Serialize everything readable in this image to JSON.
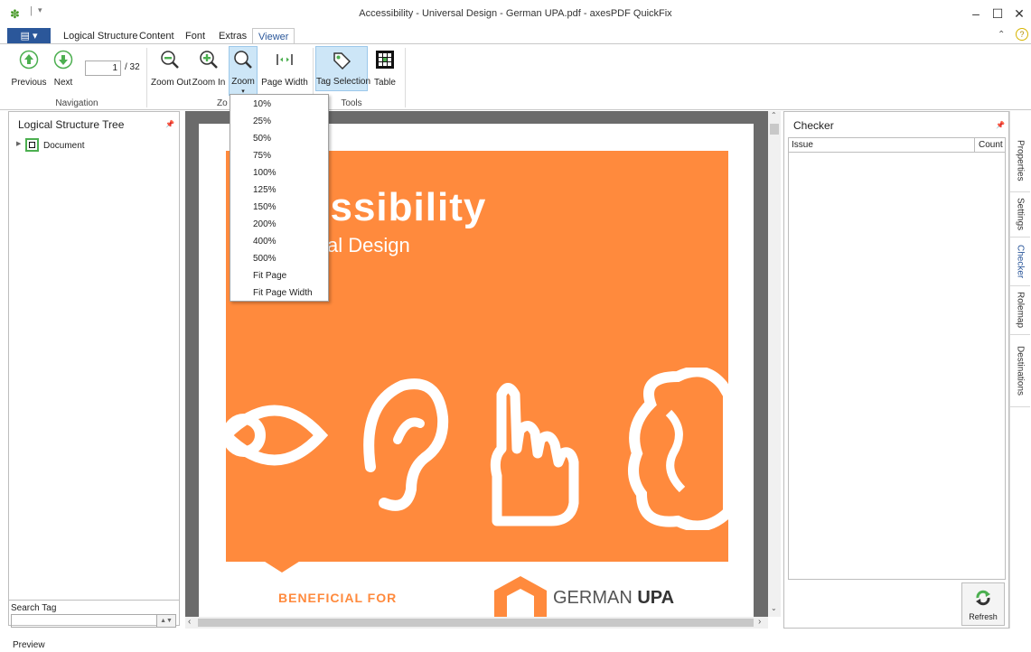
{
  "window": {
    "title": "Accessibility - Universal Design - German UPA.pdf - axesPDF QuickFix",
    "minimize": "–",
    "maximize": "☐",
    "close": "✕"
  },
  "ribbon_tabs": {
    "file": "▤ ▾",
    "items": [
      "Logical Structure",
      "Content",
      "Font",
      "Extras",
      "Viewer"
    ],
    "active": "Viewer"
  },
  "ribbon": {
    "navigation": {
      "previous": "Previous",
      "next": "Next",
      "page_value": "1",
      "page_total": "/ 32",
      "group_label": "Navigation"
    },
    "zoom": {
      "zoom_out": "Zoom Out",
      "zoom_in": "Zoom In",
      "zoom": "Zoom",
      "page_width": "Page Width",
      "group_label": "Zo"
    },
    "tools": {
      "tag_selection": "Tag Selection",
      "table": "Table",
      "group_label": "Tools"
    }
  },
  "zoom_menu": {
    "options": [
      "10%",
      "25%",
      "50%",
      "75%",
      "100%",
      "125%",
      "150%",
      "200%",
      "400%",
      "500%",
      "Fit Page",
      "Fit Page Width"
    ]
  },
  "left_pane": {
    "title": "Logical Structure Tree",
    "tree_root": "Document",
    "search_label": "Search Tag",
    "search_value": ""
  },
  "document": {
    "headline_partial": "essibility",
    "subhead_partial": "al Design",
    "footer_left": "BENEFICIAL FOR",
    "footer_logo_light": "GERMAN ",
    "footer_logo_bold": "UPA"
  },
  "checker": {
    "title": "Checker",
    "col_issue": "Issue",
    "col_count": "Count",
    "refresh": "Refresh"
  },
  "side_tabs": [
    "Properties",
    "Settings",
    "Checker",
    "Rolemap",
    "Destinations"
  ],
  "status": {
    "text": "Preview"
  },
  "colors": {
    "accent": "#2b579a",
    "orange": "#ff8a3d",
    "green": "#4caf50"
  }
}
